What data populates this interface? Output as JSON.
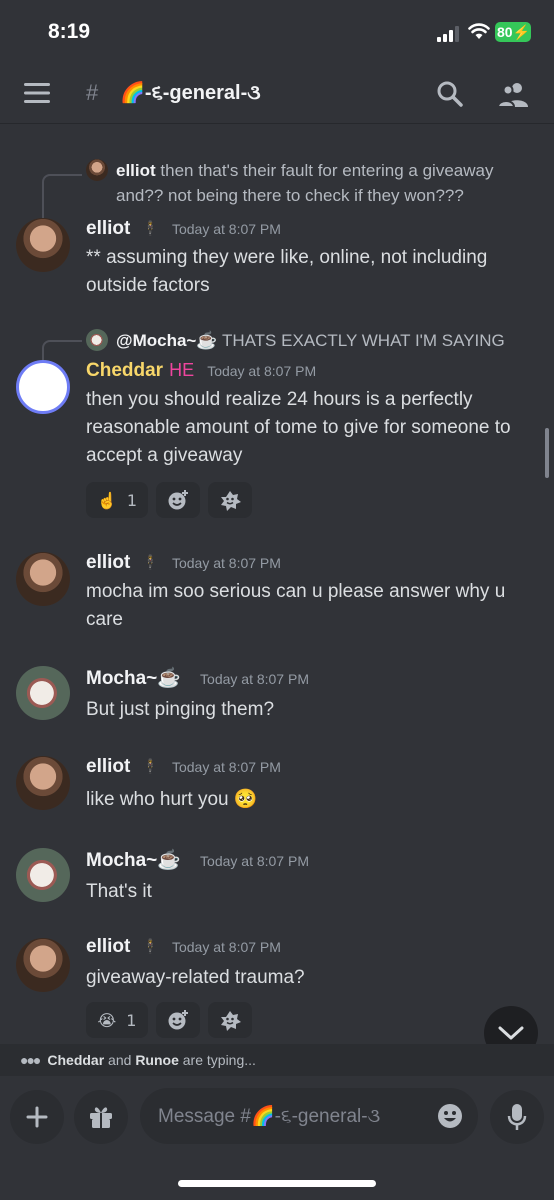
{
  "status_bar": {
    "time": "8:19",
    "battery": "80"
  },
  "header": {
    "hash": "#",
    "channel_name": "🌈-૬-general-૩"
  },
  "messages": [
    {
      "reply": {
        "author": "elliot",
        "text": "then that's their fault for entering a giveaway and?? not being there to check if they won???"
      },
      "author": "elliot",
      "timestamp": "Today at 8:07 PM",
      "text": "** assuming they were like, online, not including outside factors"
    },
    {
      "reply": {
        "author": "@Mocha~☕",
        "text": "THATS EXACTLY WHAT I'M SAYING"
      },
      "author": "Cheddar",
      "tag": "HE",
      "timestamp": "Today at 8:07 PM",
      "text": "then you should realize 24 hours is a perfectly reasonable amount of tome to give for someone to accept a giveaway",
      "reactions": [
        {
          "emoji": "☝️",
          "count": "1"
        }
      ]
    },
    {
      "author": "elliot",
      "timestamp": "Today at 8:07 PM",
      "text": "mocha im soo serious can u please answer why u care"
    },
    {
      "author": "Mocha~☕",
      "timestamp": "Today at 8:07 PM",
      "text": "But just pinging them?"
    },
    {
      "author": "elliot",
      "timestamp": "Today at 8:07 PM",
      "text": "like who hurt you 🥺"
    },
    {
      "author": "Mocha~☕",
      "timestamp": "Today at 8:07 PM",
      "text": "That's it"
    },
    {
      "author": "elliot",
      "timestamp": "Today at 8:07 PM",
      "text": "giveaway-related trauma?",
      "reactions": [
        {
          "emoji": "😭",
          "count": "1"
        }
      ]
    }
  ],
  "typing": {
    "user1": "Cheddar",
    "conj": " and ",
    "user2": "Runoe",
    "suffix": " are typing..."
  },
  "composer": {
    "placeholder": "Message #🌈-૬-general-૩"
  },
  "icons": {
    "menu": "menu-icon",
    "search": "search-icon",
    "members": "members-icon",
    "add_reaction": "add-reaction-icon",
    "super_reaction": "super-reaction-icon",
    "scroll_down": "chevron-down-icon",
    "plus": "plus-icon",
    "gift": "gift-icon",
    "emoji": "emoji-icon",
    "mic": "microphone-icon"
  },
  "colors": {
    "background": "#313338",
    "cheddar_name": "#f8d76a",
    "he_tag": "#ee459e",
    "battery": "#35c759"
  }
}
